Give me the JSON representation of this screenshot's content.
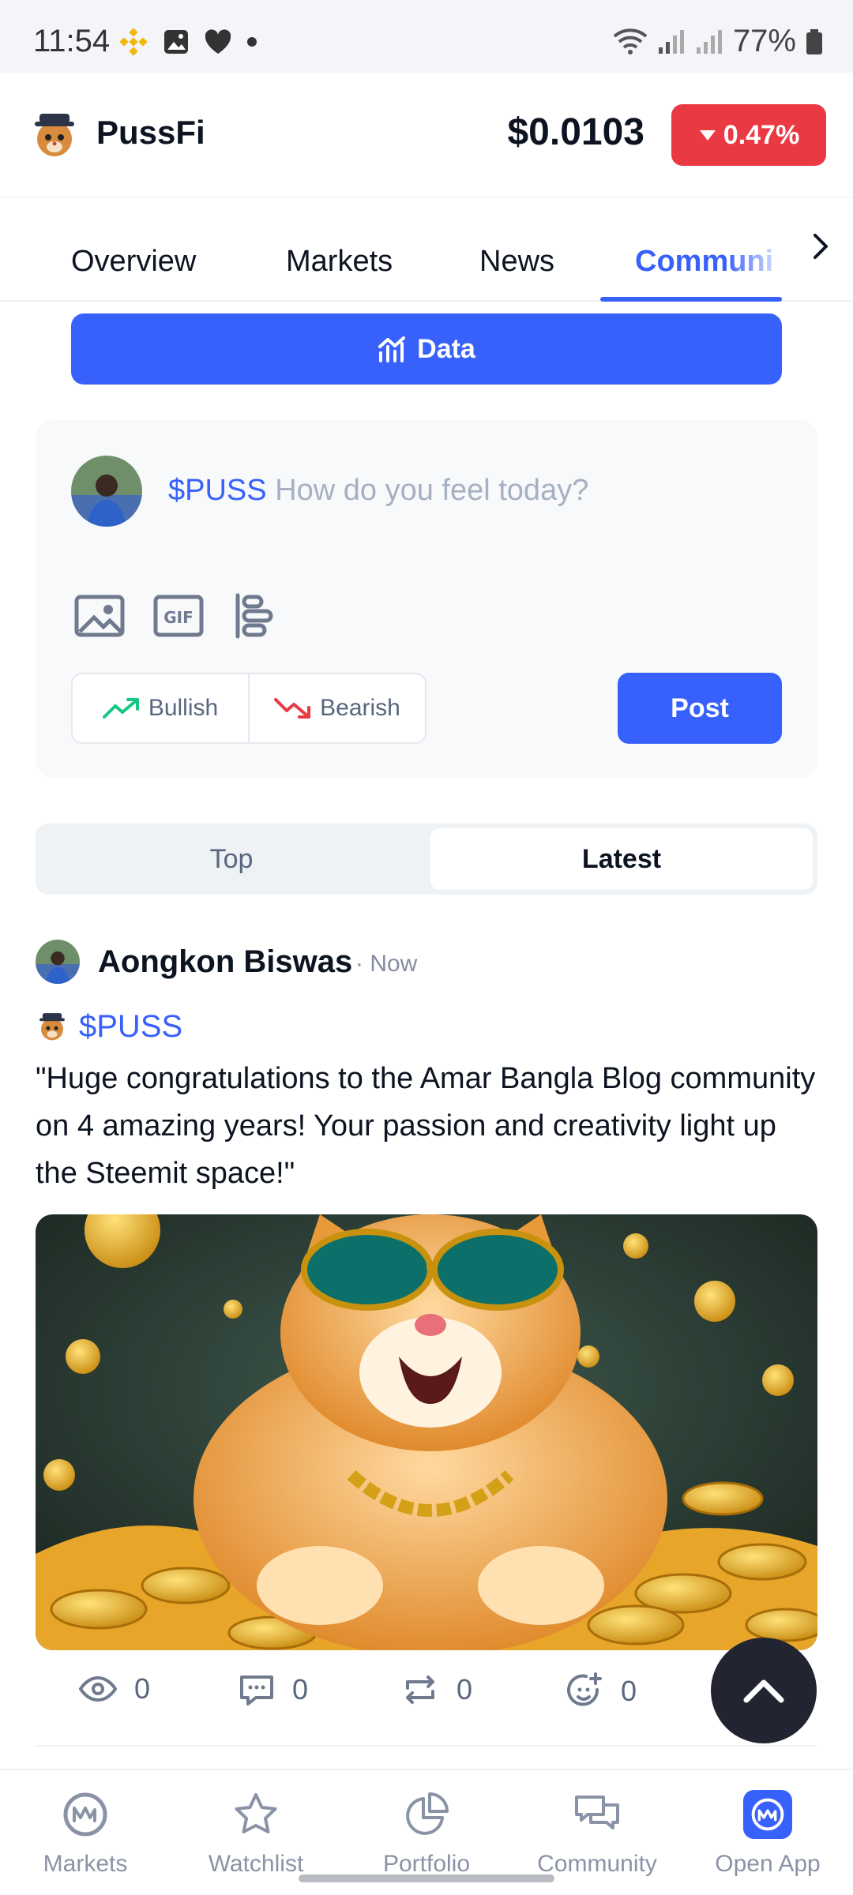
{
  "status_bar": {
    "time": "11:54",
    "battery": "77%"
  },
  "header": {
    "coin_name": "PussFi",
    "price": "$0.0103",
    "change": "0.47%"
  },
  "tabs": [
    {
      "label": "Overview"
    },
    {
      "label": "Markets"
    },
    {
      "label": "News"
    },
    {
      "label": "Communi"
    }
  ],
  "data_button": {
    "label": "Data"
  },
  "composer": {
    "tag": "$PUSS",
    "placeholder": "How do you feel today?",
    "bullish": "Bullish",
    "bearish": "Bearish",
    "post": "Post"
  },
  "feed_tabs": {
    "top": "Top",
    "latest": "Latest"
  },
  "post": {
    "author": "Aongkon Biswas",
    "time": "· Now",
    "tag": "$PUSS",
    "body": "\"Huge congratulations to the Amar Bangla Blog community on 4 amazing years! Your passion and creativity light up the Steemit space!\"",
    "views": "0",
    "comments": "0",
    "reposts": "0",
    "reactions": "0"
  },
  "bottom_nav": [
    {
      "label": "Markets"
    },
    {
      "label": "Watchlist"
    },
    {
      "label": "Portfolio"
    },
    {
      "label": "Community"
    },
    {
      "label": "Open App"
    }
  ],
  "colors": {
    "accent": "#3861fb",
    "negative": "#ea3943",
    "positive": "#16c784",
    "dark_button": "#222531"
  }
}
